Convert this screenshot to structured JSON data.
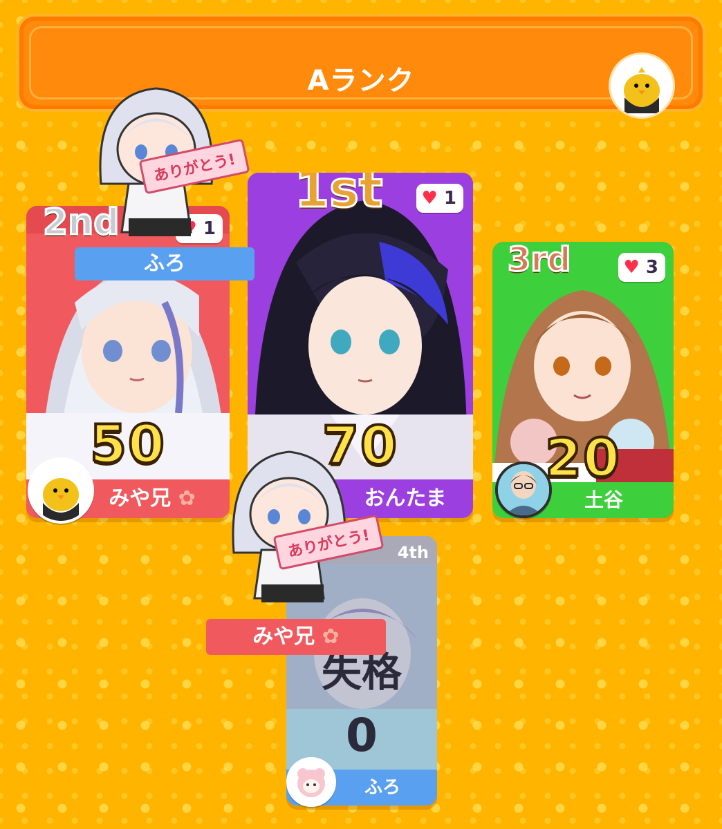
{
  "header": {
    "title": "Aランク"
  },
  "colors": {
    "accent": "#ff8a0c",
    "second_bg": "#f05a5f",
    "first_bg": "#9b3fe0",
    "third_bg": "#3ecf3c",
    "fourth_bg": "#5aa0f0"
  },
  "cards": [
    {
      "rank": "1st",
      "score": "70",
      "likes": "1",
      "name": "おんたま"
    },
    {
      "rank": "2nd",
      "score": "50",
      "likes": "1",
      "name": "みや兄",
      "thanks_name": "ふろ"
    },
    {
      "rank": "3rd",
      "score": "20",
      "likes": "3",
      "name": "土谷"
    },
    {
      "rank": "4th",
      "score": "0",
      "status": "失格",
      "name": "ふろ",
      "thanks_name": "みや兄"
    }
  ],
  "thanks_sign": "ありがとう!"
}
